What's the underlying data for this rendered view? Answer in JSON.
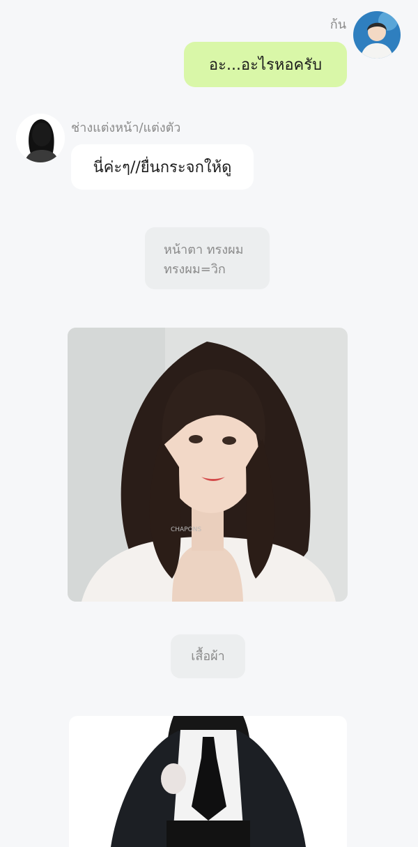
{
  "chat": {
    "me": {
      "name": "ก้น",
      "message": "อะ...อะไรหอครับ"
    },
    "makeup_artist": {
      "name": "ช่างแต่งหน้า/แต่งตัว",
      "message": "นี่ค่ะๆ//ยื่นกระจกให้ดู"
    },
    "narration_face": {
      "line1": "หน้าตา ทรงผม",
      "line2": "ทรงผม=วิก"
    },
    "photo_hair_watermark": "CHAPONS",
    "narration_clothes": "เสื้อผ้า"
  },
  "colors": {
    "page_bg": "#f6f7f9",
    "my_bubble": "#d9f7a8",
    "their_bubble": "#ffffff",
    "narration_bg": "#eceeef"
  }
}
